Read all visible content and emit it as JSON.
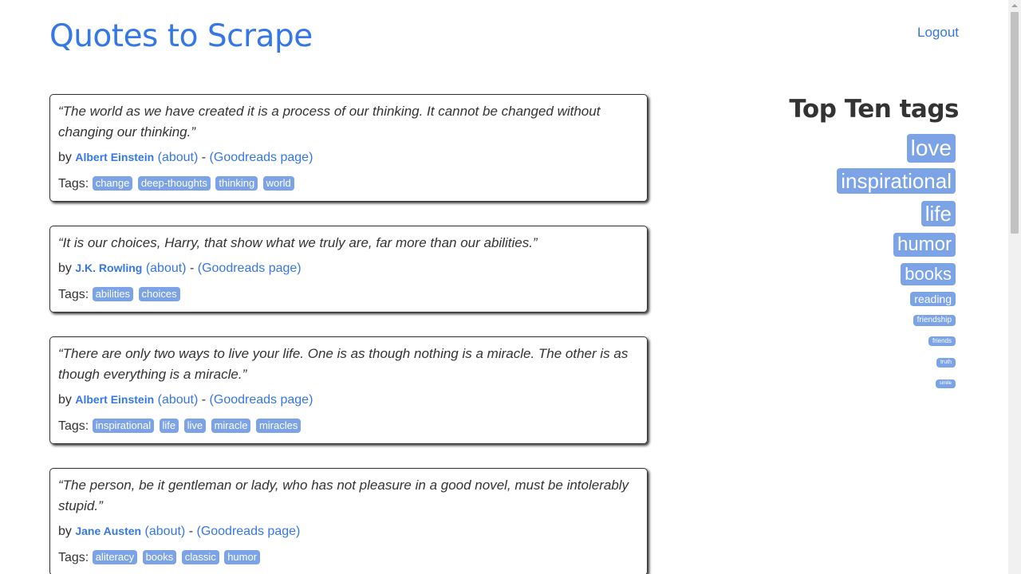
{
  "header": {
    "site_title": "Quotes to Scrape",
    "logout": "Logout"
  },
  "quotes": [
    {
      "text": "“The world as we have created it is a process of our thinking. It cannot be changed without changing our thinking.”",
      "by": "by",
      "author": "Albert Einstein",
      "about": "(about)",
      "sep": "-",
      "goodreads": "(Goodreads page)",
      "tags_label": "Tags:",
      "tags": [
        "change",
        "deep-thoughts",
        "thinking",
        "world"
      ]
    },
    {
      "text": "“It is our choices, Harry, that show what we truly are, far more than our abilities.”",
      "by": "by",
      "author": "J.K. Rowling",
      "about": "(about)",
      "sep": "-",
      "goodreads": "(Goodreads page)",
      "tags_label": "Tags:",
      "tags": [
        "abilities",
        "choices"
      ]
    },
    {
      "text": "“There are only two ways to live your life. One is as though nothing is a miracle. The other is as though everything is a miracle.”",
      "by": "by",
      "author": "Albert Einstein",
      "about": "(about)",
      "sep": "-",
      "goodreads": "(Goodreads page)",
      "tags_label": "Tags:",
      "tags": [
        "inspirational",
        "life",
        "live",
        "miracle",
        "miracles"
      ]
    },
    {
      "text": "“The person, be it gentleman or lady, who has not pleasure in a good novel, must be intolerably stupid.”",
      "by": "by",
      "author": "Jane Austen",
      "about": "(about)",
      "sep": "-",
      "goodreads": "(Goodreads page)",
      "tags_label": "Tags:",
      "tags": [
        "aliteracy",
        "books",
        "classic",
        "humor"
      ]
    }
  ],
  "sidebar": {
    "title": "Top Ten tags",
    "tags": [
      "love",
      "inspirational",
      "life",
      "humor",
      "books",
      "reading",
      "friendship",
      "friends",
      "truth",
      "simile"
    ]
  },
  "colors": {
    "link": "#3677e8",
    "tag_bg": "#7ca3e6",
    "text": "#333333"
  }
}
